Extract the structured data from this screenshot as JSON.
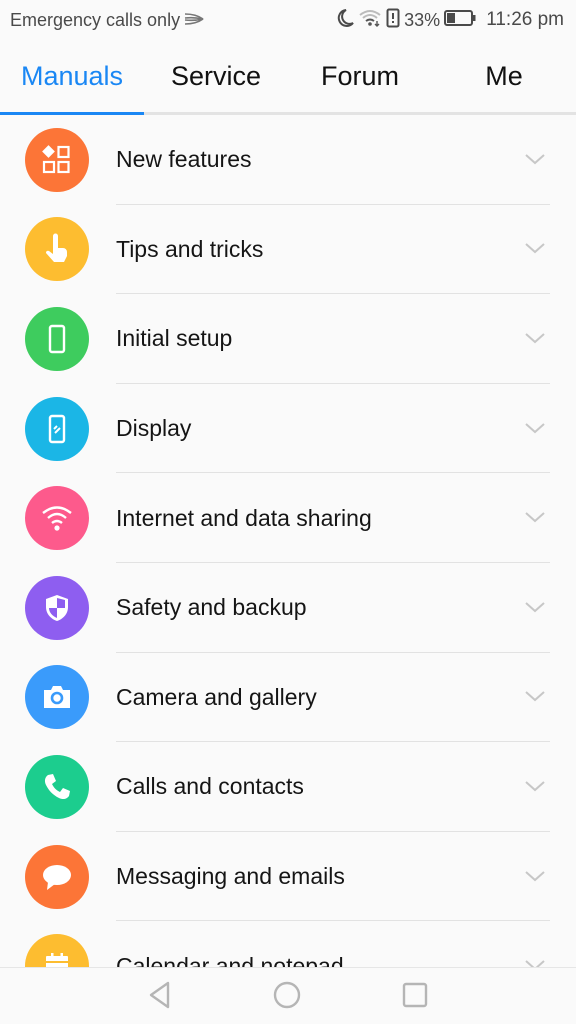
{
  "status_bar": {
    "carrier_text": "Emergency calls only",
    "battery_percent": "33%",
    "battery_level": 0.33,
    "time": "11:26 pm",
    "icons": [
      "signal-swoosh-icon",
      "moon-icon",
      "wifi-icon",
      "battery-alert-icon",
      "battery-icon"
    ]
  },
  "tabs": [
    {
      "label": "Manuals",
      "active": true
    },
    {
      "label": "Service",
      "active": false
    },
    {
      "label": "Forum",
      "active": false
    },
    {
      "label": "Me",
      "active": false
    }
  ],
  "accent_color": "#1a87f4",
  "manual_sections": [
    {
      "label": "New features",
      "icon": "apps-grid-icon",
      "color": "#fc7537"
    },
    {
      "label": "Tips and tricks",
      "icon": "hand-pointer-icon",
      "color": "#fdbd30"
    },
    {
      "label": "Initial setup",
      "icon": "phone-device-icon",
      "color": "#3ecc5e"
    },
    {
      "label": "Display",
      "icon": "display-phone-icon",
      "color": "#1bb6e6"
    },
    {
      "label": "Internet and data sharing",
      "icon": "wifi-icon",
      "color": "#fd5a8c"
    },
    {
      "label": "Safety and backup",
      "icon": "shield-icon",
      "color": "#8e5ef0"
    },
    {
      "label": "Camera and gallery",
      "icon": "camera-icon",
      "color": "#3a9bfb"
    },
    {
      "label": "Calls and contacts",
      "icon": "phone-call-icon",
      "color": "#1ccd8e"
    },
    {
      "label": "Messaging and emails",
      "icon": "chat-bubble-icon",
      "color": "#fc7537"
    },
    {
      "label": "Calendar and notepad",
      "icon": "calendar-icon",
      "color": "#fdbd30"
    }
  ],
  "nav_bar": {
    "buttons": [
      "back",
      "home",
      "recents"
    ]
  }
}
